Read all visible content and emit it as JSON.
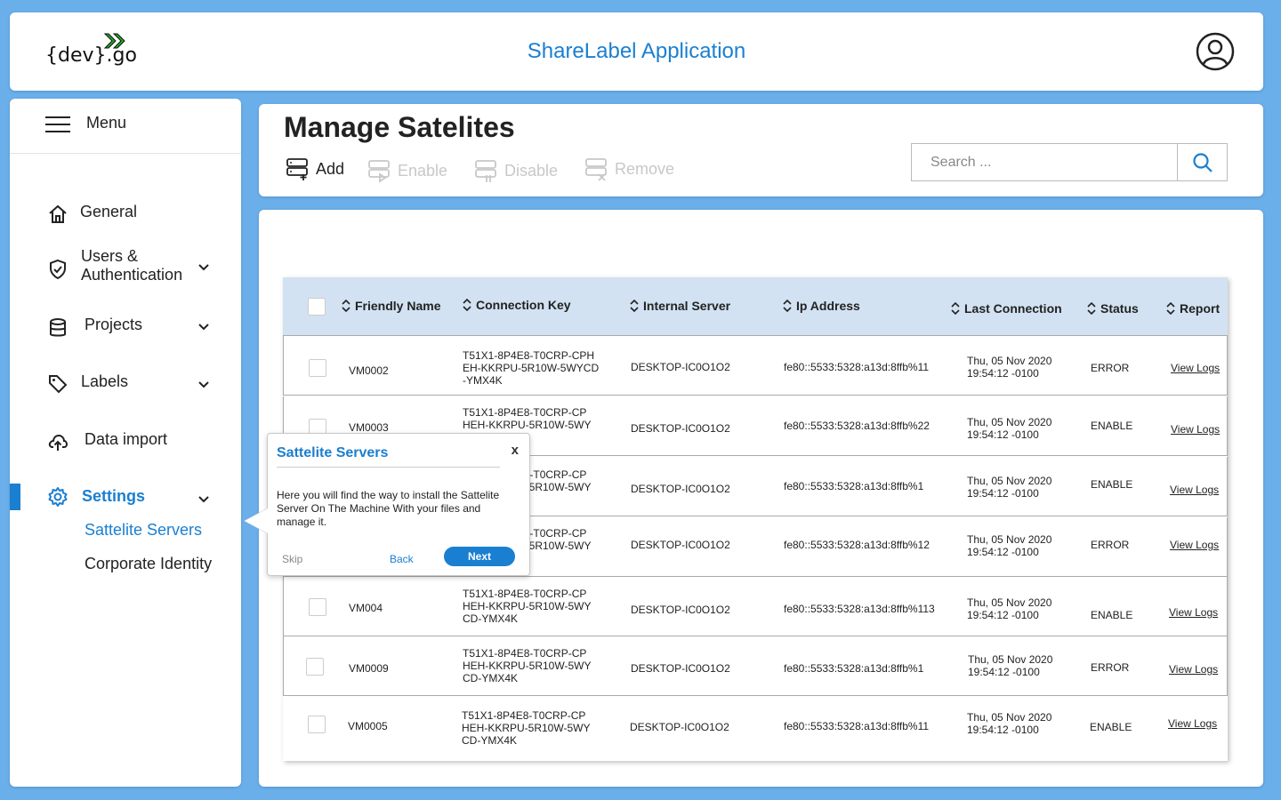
{
  "header": {
    "logo_text": "{dev}.go",
    "app_title": "ShareLabel Application"
  },
  "sidebar": {
    "menu_label": "Menu",
    "items": [
      {
        "label": "General",
        "icon": "home-icon"
      },
      {
        "label": "Users &\nAuthentication",
        "icon": "shield-check-icon"
      },
      {
        "label": "Projects",
        "icon": "database-icon"
      },
      {
        "label": "Labels",
        "icon": "tag-icon"
      },
      {
        "label": "Data import",
        "icon": "cloud-upload-icon"
      },
      {
        "label": "Settings",
        "icon": "gear-icon"
      }
    ],
    "sub_items": [
      "Sattelite Servers",
      "Corporate Identity"
    ]
  },
  "toolbar": {
    "title": "Manage Satelites",
    "add_label": "Add",
    "enable_label": "Enable",
    "disable_label": "Disable",
    "remove_label": "Remove",
    "search_placeholder": "Search ..."
  },
  "table": {
    "columns": [
      "Friendly Name",
      "Connection Key",
      "Internal Server",
      "Ip Address",
      "Last Connection",
      "Status",
      "Report"
    ],
    "rows": [
      {
        "name": "VM0002",
        "key": [
          "T51X1-8P4E8-T0CRP-CPH",
          "EH-KKRPU-5R10W-5WYCD",
          "-YMX4K"
        ],
        "server": "DESKTOP-IC0O1O2",
        "ip": "fe80::5533:5328:a13d:8ffb%11",
        "last": [
          "Thu, 05 Nov 2020",
          "19:54:12 -0100"
        ],
        "status": "ERROR",
        "report": "View Logs"
      },
      {
        "name": "VM0003",
        "key": [
          "T51X1-8P4E8-T0CRP-CP",
          "HEH-KKRPU-5R10W-5WY",
          ""
        ],
        "server": "DESKTOP-IC0O1O2",
        "ip": "fe80::5533:5328:a13d:8ffb%22",
        "last": [
          "Thu, 05 Nov 2020",
          "19:54:12 -0100"
        ],
        "status": "ENABLE",
        "report": "View Logs"
      },
      {
        "name": "",
        "key": [
          "T51X1-8P4E8-T0CRP-CP",
          "HEH-KKRPU-5R10W-5WY",
          ""
        ],
        "server": "DESKTOP-IC0O1O2",
        "ip": "fe80::5533:5328:a13d:8ffb%1",
        "last": [
          "Thu, 05 Nov 2020",
          "19:54:12 -0100"
        ],
        "status": "ENABLE",
        "report": "View Logs"
      },
      {
        "name": "",
        "key": [
          "T51X1-8P4E8-T0CRP-CP",
          "HEH-KKRPU-5R10W-5WY",
          ""
        ],
        "server": "DESKTOP-IC0O1O2",
        "ip": "fe80::5533:5328:a13d:8ffb%12",
        "last": [
          "Thu, 05 Nov 2020",
          "19:54:12 -0100"
        ],
        "status": "ERROR",
        "report": "View Logs"
      },
      {
        "name": "VM004",
        "key": [
          "T51X1-8P4E8-T0CRP-CP",
          "HEH-KKRPU-5R10W-5WY",
          "CD-YMX4K"
        ],
        "server": "DESKTOP-IC0O1O2",
        "ip": "fe80::5533:5328:a13d:8ffb%113",
        "last": [
          "Thu, 05 Nov 2020",
          "19:54:12 -0100"
        ],
        "status": "ENABLE",
        "report": "View Logs"
      },
      {
        "name": "VM0009",
        "key": [
          "T51X1-8P4E8-T0CRP-CP",
          "HEH-KKRPU-5R10W-5WY",
          "CD-YMX4K"
        ],
        "server": "DESKTOP-IC0O1O2",
        "ip": "fe80::5533:5328:a13d:8ffb%1",
        "last": [
          "Thu, 05 Nov 2020",
          "19:54:12 -0100"
        ],
        "status": "ERROR",
        "report": "View Logs"
      },
      {
        "name": "VM0005",
        "key": [
          "T51X1-8P4E8-T0CRP-CP",
          "HEH-KKRPU-5R10W-5WY",
          "CD-YMX4K"
        ],
        "server": "DESKTOP-IC0O1O2",
        "ip": "fe80::5533:5328:a13d:8ffb%11",
        "last": [
          "Thu, 05 Nov 2020",
          "19:54:12 -0100"
        ],
        "status": "ENABLE",
        "report": "View Logs"
      }
    ]
  },
  "popover": {
    "title": "Sattelite Servers",
    "close": "x",
    "body": "Here you will find the way to install the Sattelite Server On The Machine With your files and manage it.",
    "skip": "Skip",
    "back": "Back",
    "next": "Next"
  },
  "colors": {
    "accent": "#1a7fd0",
    "background": "#6aaeea",
    "table_header": "#d2e2f2",
    "logo_arrow": "#22aa22"
  }
}
